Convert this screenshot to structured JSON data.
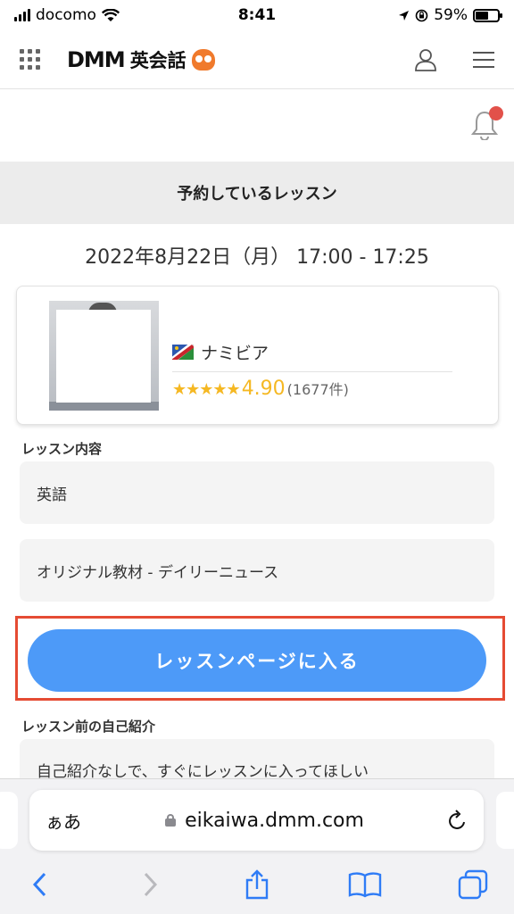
{
  "status_bar": {
    "carrier": "docomo",
    "time": "8:41",
    "battery_percent": "59%",
    "battery_level": 0.59
  },
  "header": {
    "brand_dmm": "DMM",
    "brand_eikaiwa": "英会話",
    "icons": [
      "grid-menu-icon",
      "owl-logo-icon",
      "user-icon",
      "hamburger-menu-icon"
    ]
  },
  "notifications": {
    "icon": "bell-icon",
    "has_unread": true,
    "badge_color": "#e2514a"
  },
  "reserved": {
    "heading": "予約しているレッスン",
    "datetime": "2022年8月22日（月） 17:00 - 17:25"
  },
  "teacher": {
    "country": "ナミビア",
    "stars": "★★★★★",
    "rating": "4.90",
    "review_count": "(1677件)",
    "rating_stars_value": 4.9
  },
  "lesson": {
    "content_label": "レッスン内容",
    "language": "英語",
    "material": "オリジナル教材 - デイリーニュース"
  },
  "enter_button": {
    "label": "レッスンページに入る",
    "color": "#4d9af8",
    "highlight_color": "#e54b33"
  },
  "intro": {
    "label": "レッスン前の自己紹介",
    "value": "自己紹介なしで、すぐにレッスンに入ってほしい"
  },
  "safari": {
    "aa_label": "ぁあ",
    "url": "eikaiwa.dmm.com",
    "toolbar_icons": [
      "back-icon",
      "forward-icon",
      "share-icon",
      "bookmarks-icon",
      "tabs-icon"
    ]
  }
}
